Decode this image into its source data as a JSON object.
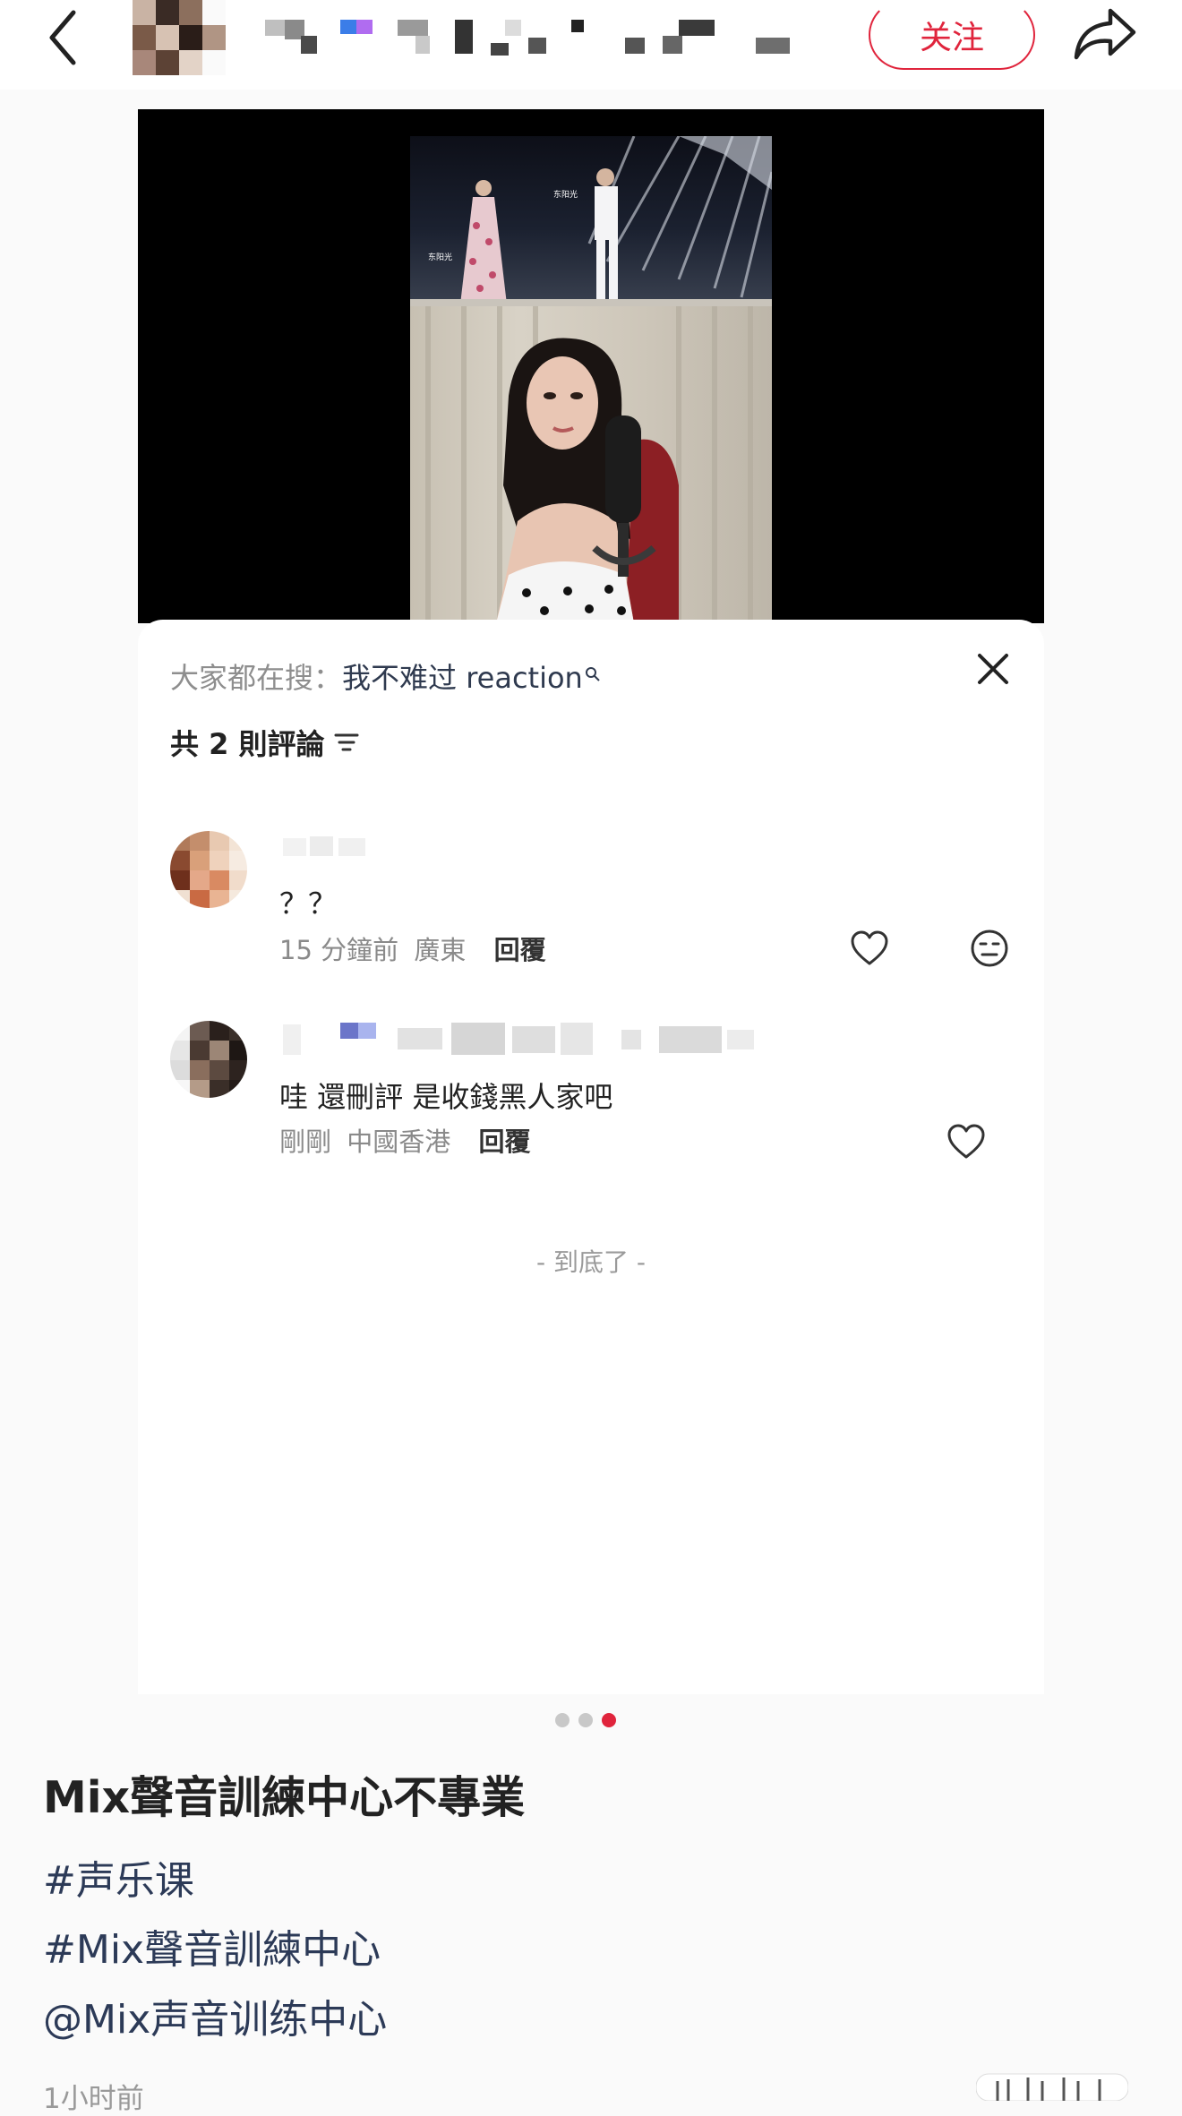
{
  "header": {
    "follow_label": "关注",
    "icons": [
      "back-icon",
      "share-icon"
    ]
  },
  "comments_sheet": {
    "search_prefix": "大家都在搜：",
    "search_keyword": "我不难过 reaction",
    "count_label": "共 2 則評論",
    "comments": [
      {
        "text": "？？",
        "time": "15 分鐘前",
        "location": "廣東",
        "reply_label": "回覆"
      },
      {
        "text": "哇 還刪評 是收錢黑人家吧",
        "time": "剛剛",
        "location": "中國香港",
        "reply_label": "回覆"
      }
    ],
    "end_label": "- 到底了 -"
  },
  "carousel": {
    "total": 3,
    "active_index": 2
  },
  "note": {
    "title": "Mix聲音訓練中心不專業",
    "tags": [
      "#声乐课",
      "#Mix聲音訓練中心"
    ],
    "mention": "@Mix声音训练中心",
    "time": "1小时前"
  },
  "colors": {
    "accent": "#e0243c",
    "link": "#2c3a57"
  }
}
